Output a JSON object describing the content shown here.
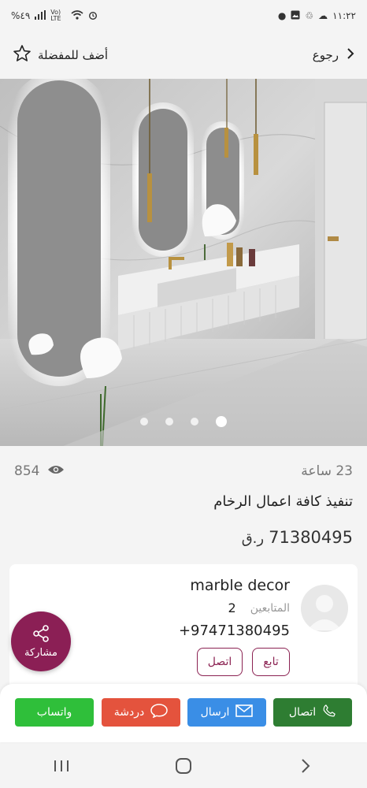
{
  "status_bar": {
    "time": "١١:٢٢",
    "battery": "%٤٩",
    "network": "Vo) LTE"
  },
  "header": {
    "back_label": "رجوع",
    "favorite_label": "أضف للمفضلة"
  },
  "gallery": {
    "image_count": 4,
    "active_index": 3
  },
  "listing": {
    "views": "854",
    "posted_ago": "23 ساعة",
    "title": "تنفيذ كافة اعمال الرخام",
    "price_value": "71380495",
    "price_currency": "ر.ق"
  },
  "seller": {
    "name": "marble decor",
    "followers_label": "المتابعين",
    "followers_count": "2",
    "phone": "+97471380495",
    "follow_label": "تابع",
    "contact_label": "اتصل"
  },
  "share": {
    "label": "مشاركة"
  },
  "actions": {
    "call_label": "اتصال",
    "message_label": "ارسال",
    "chat_label": "دردشة",
    "whatsapp_label": "واتساب"
  },
  "colors": {
    "brand": "#8b1f55",
    "call": "#2e7d32",
    "message": "#3a8ee6",
    "chat": "#e4533d",
    "whatsapp": "#2fbf3a"
  }
}
